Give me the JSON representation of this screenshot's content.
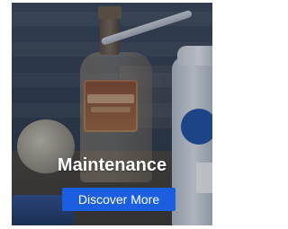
{
  "card": {
    "title": "Maintenance",
    "button_label": "Discover More"
  },
  "colors": {
    "button_bg": "#1b5fe0",
    "title_text": "#ffffff"
  },
  "imagery": {
    "icons": [
      "bottle-image",
      "spray-can-image",
      "twine-ball-image",
      "tool-image"
    ]
  }
}
